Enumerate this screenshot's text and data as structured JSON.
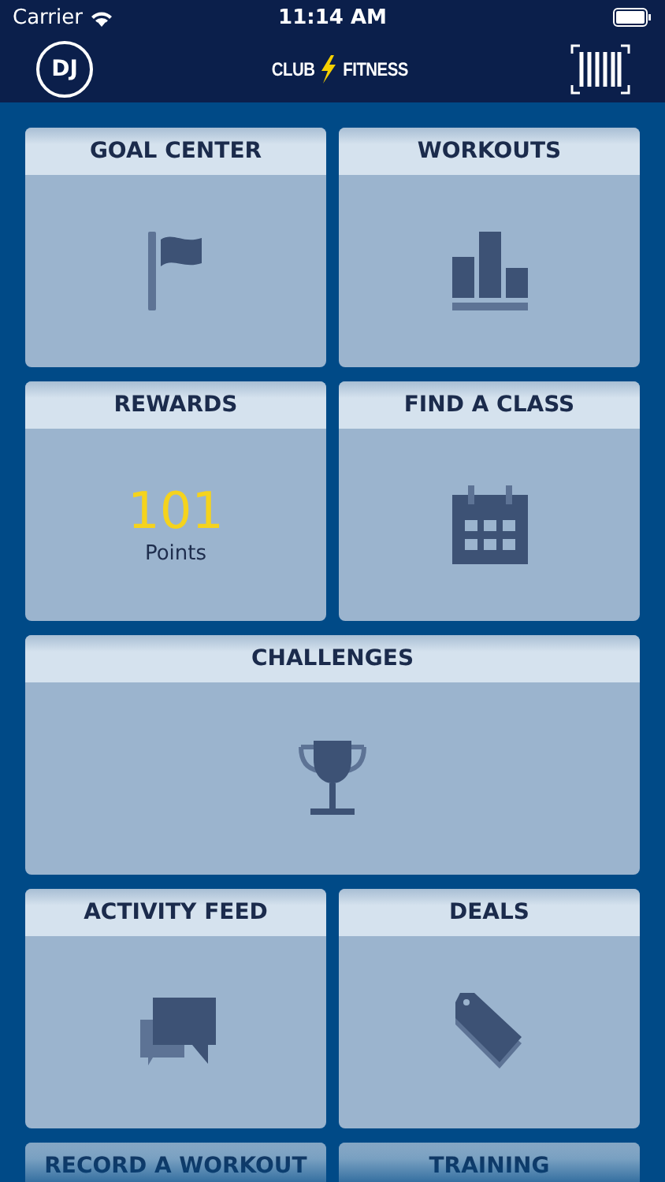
{
  "status_bar": {
    "carrier": "Carrier",
    "time": "11:14 AM"
  },
  "nav": {
    "avatar": "DJ",
    "logo": [
      "CLUB",
      "FITNESS"
    ]
  },
  "tiles": [
    {
      "title": "GOAL CENTER",
      "kind": "flag",
      "wide": false
    },
    {
      "title": "WORKOUTS",
      "kind": "bars",
      "wide": false
    },
    {
      "title": "REWARDS",
      "kind": "points",
      "wide": false,
      "value": "101",
      "unit": "Points"
    },
    {
      "title": "FIND A CLASS",
      "kind": "calendar",
      "wide": false
    },
    {
      "title": "CHALLENGES",
      "kind": "trophy",
      "wide": true
    },
    {
      "title": "ACTIVITY FEED",
      "kind": "chat",
      "wide": false
    },
    {
      "title": "DEALS",
      "kind": "tag",
      "wide": false
    },
    {
      "title": "RECORD A WORKOUT",
      "kind": "none",
      "wide": false
    },
    {
      "title": "TRAINING",
      "kind": "none",
      "wide": false
    }
  ]
}
